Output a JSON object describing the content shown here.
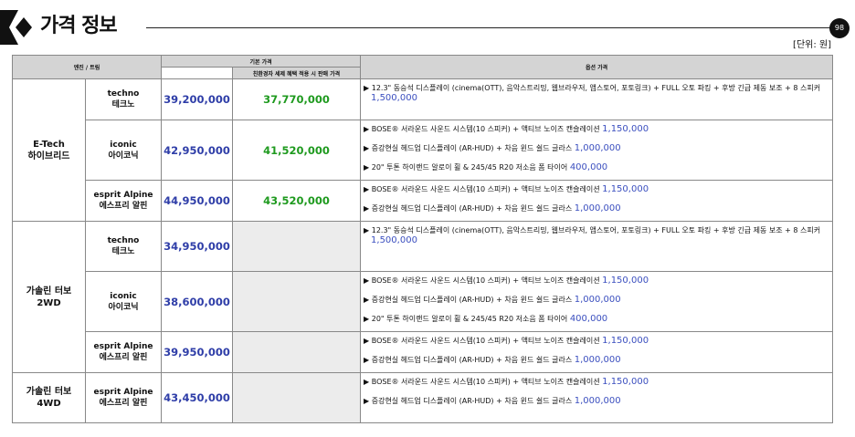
{
  "header": {
    "title": "가격 정보",
    "page_number": "98",
    "unit_note": "[단위: 원]"
  },
  "table": {
    "headers": {
      "engine_trim": "엔진 / 트림",
      "base_price": "기본 가격",
      "eco_price": "친환경자 세제 혜택 적용 시 판매 가격",
      "options": "옵션 가격"
    },
    "rows": [
      {
        "engine": "E-Tech\n하이브리드",
        "trim": "techno\n테크노",
        "price": "39,200,000",
        "discount": "37,770,000",
        "options": [
          {
            "text": "12.3\" 동승석 디스플레이 (cinema(OTT), 음악스트리밍, 웹브라우저, 앱스토어, 포토링크) + FULL 오토 파킹 + 후방 긴급 제동 보조 + 8 스피커",
            "price": "1,500,000",
            "wrap": true
          }
        ]
      },
      {
        "engine": "",
        "trim": "iconic\n아이코닉",
        "price": "42,950,000",
        "discount": "41,520,000",
        "options": [
          {
            "text": "BOSE® 서라운드 사운드 시스템(10 스피커) + 액티브 노이즈 캔슬레이션",
            "price": "1,150,000"
          },
          {
            "text": "증강현실 헤드업 디스플레이 (AR-HUD) + 차음 윈드 쉴드 글라스",
            "price": "1,000,000"
          },
          {
            "text": "20\" 투톤 하이랜드 알로이 휠 & 245/45 R20 저소음 폼 타이어",
            "price": "400,000"
          }
        ]
      },
      {
        "engine": "",
        "trim": "esprit Alpine\n에스프리 알핀",
        "price": "44,950,000",
        "discount": "43,520,000",
        "options": [
          {
            "text": "BOSE® 서라운드 사운드 시스템(10 스피커) + 액티브 노이즈 캔슬레이션",
            "price": "1,150,000"
          },
          {
            "text": "증강현실 헤드업 디스플레이 (AR-HUD) + 차음 윈드 쉴드 글라스",
            "price": "1,000,000"
          }
        ]
      },
      {
        "engine": "가솔린 터보\n2WD",
        "trim": "techno\n테크노",
        "price": "34,950,000",
        "discount": "",
        "options": [
          {
            "text": "12.3\" 동승석 디스플레이 (cinema(OTT), 음악스트리밍, 웹브라우저, 앱스토어, 포토링크) + FULL 오토 파킹 + 후방 긴급 제동 보조 + 8 스피커",
            "price": "1,500,000",
            "wrap": true
          }
        ]
      },
      {
        "engine": "",
        "trim": "iconic\n아이코닉",
        "price": "38,600,000",
        "discount": "",
        "options": [
          {
            "text": "BOSE® 서라운드 사운드 시스템(10 스피커) + 액티브 노이즈 캔슬레이션",
            "price": "1,150,000"
          },
          {
            "text": "증강현실 헤드업 디스플레이 (AR-HUD) + 차음 윈드 쉴드 글라스",
            "price": "1,000,000"
          },
          {
            "text": "20\" 투톤 하이랜드 알로이 휠 & 245/45 R20 저소음 폼 타이어",
            "price": "400,000"
          }
        ]
      },
      {
        "engine": "",
        "trim": "esprit Alpine\n에스프리 알핀",
        "price": "39,950,000",
        "discount": "",
        "options": [
          {
            "text": "BOSE® 서라운드 사운드 시스템(10 스피커) + 액티브 노이즈 캔슬레이션",
            "price": "1,150,000"
          },
          {
            "text": "증강현실 헤드업 디스플레이 (AR-HUD) + 차음 윈드 쉴드 글라스",
            "price": "1,000,000"
          }
        ]
      },
      {
        "engine": "가솔린 터보\n4WD",
        "trim": "esprit Alpine\n에스프리 알핀",
        "price": "43,450,000",
        "discount": "",
        "options": [
          {
            "text": "BOSE® 서라운드 사운드 시스템(10 스피커) + 액티브 노이즈 캔슬레이션",
            "price": "1,150,000"
          },
          {
            "text": "증강현실 헤드업 디스플레이 (AR-HUD) + 차음 윈드 쉴드 글라스",
            "price": "1,000,000"
          }
        ]
      }
    ]
  }
}
